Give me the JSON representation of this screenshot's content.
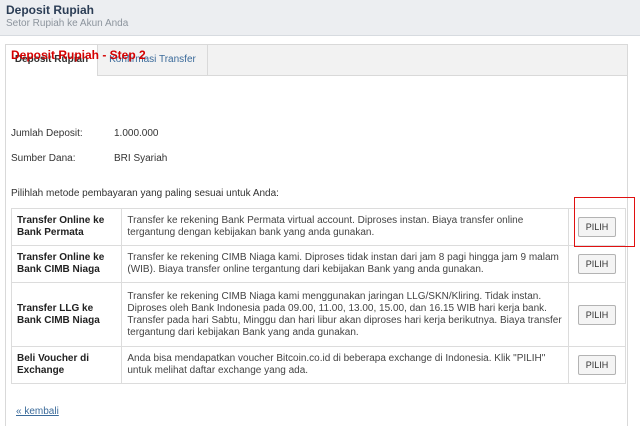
{
  "header": {
    "title": "Deposit Rupiah",
    "subtitle": "Setor Rupiah ke Akun Anda"
  },
  "tabs": [
    {
      "label": "Deposit Rupiah",
      "active": true
    },
    {
      "label": "Konfirmasi Transfer",
      "active": false
    }
  ],
  "step_title": "Deposit Rupiah - Step 2",
  "summary": [
    {
      "label": "Jumlah Deposit:",
      "value": "1.000.000"
    },
    {
      "label": "Sumber Dana:",
      "value": "BRI Syariah"
    }
  ],
  "intro": "Pilihlah metode pembayaran yang paling sesuai untuk Anda:",
  "methods": [
    {
      "name": "Transfer Online ke Bank Permata",
      "description": "Transfer ke rekening Bank Permata virtual account. Diproses instan. Biaya transfer online tergantung dengan kebijakan bank yang anda gunakan.",
      "button": "PILIH",
      "highlighted": true
    },
    {
      "name": "Transfer Online ke Bank CIMB Niaga",
      "description": "Transfer ke rekening CIMB Niaga kami. Diproses tidak instan dari jam 8 pagi hingga jam 9 malam (WIB). Biaya transfer online tergantung dari kebijakan Bank yang anda gunakan.",
      "button": "PILIH",
      "highlighted": false
    },
    {
      "name": "Transfer LLG ke Bank CIMB Niaga",
      "description": "Transfer ke rekening CIMB Niaga kami menggunakan jaringan LLG/SKN/Kliring. Tidak instan. Diproses oleh Bank Indonesia pada 09.00, 11.00, 13.00, 15.00, dan 16.15 WIB hari kerja bank. Transfer pada hari Sabtu, Minggu dan hari libur akan diproses hari kerja berikutnya. Biaya transfer tergantung dari kebijakan Bank yang anda gunakan.",
      "button": "PILIH",
      "highlighted": false
    },
    {
      "name": "Beli Voucher di Exchange",
      "description": "Anda bisa mendapatkan voucher Bitcoin.co.id di beberapa exchange di Indonesia. Klik \"PILIH\" untuk melihat daftar exchange yang ada.",
      "button": "PILIH",
      "highlighted": false
    }
  ],
  "back_link": "« kembali",
  "colors": {
    "step_title": "#d40000",
    "highlight_box": "#e01010",
    "link": "#3a6a9a"
  }
}
